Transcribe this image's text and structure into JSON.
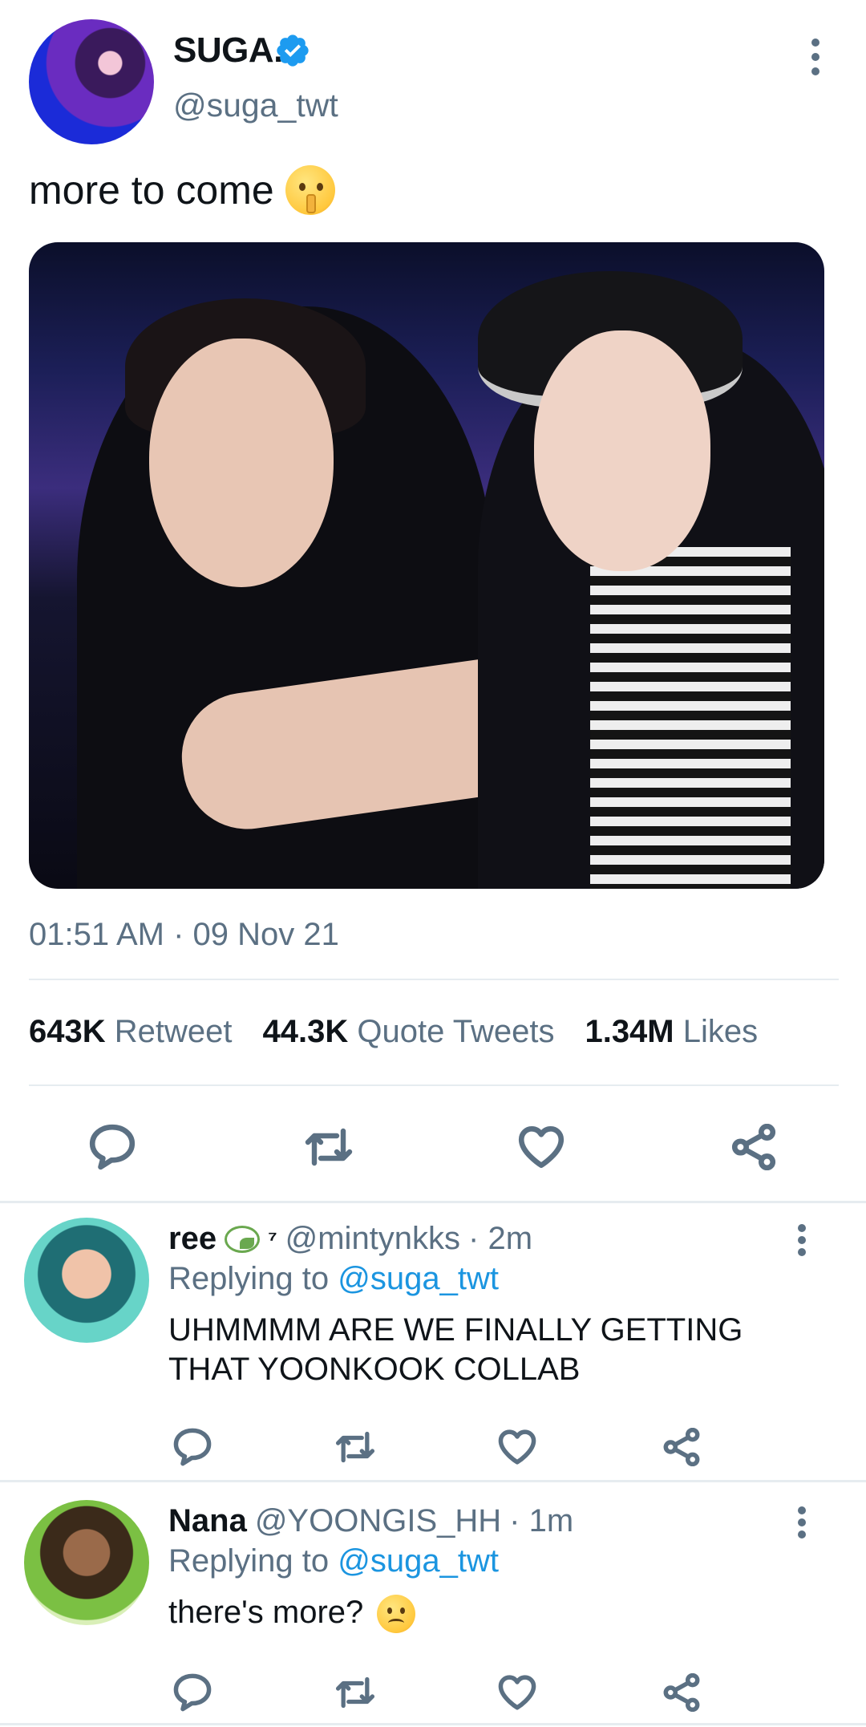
{
  "tweet": {
    "display_name": "SUGA.",
    "verified_icon": "verified-badge-icon",
    "handle": "@suga_twt",
    "text": "more to come",
    "text_emoji": "shushing-face",
    "media_description_icon": "photo",
    "timestamp": "01:51 AM · 09 Nov 21",
    "stats": {
      "retweets_count": "643K",
      "retweets_label": "Retweet",
      "quotes_count": "44.3K",
      "quotes_label": "Quote Tweets",
      "likes_count": "1.34M",
      "likes_label": "Likes"
    },
    "accent_color": "#1b95e0"
  },
  "replies": [
    {
      "name": "ree",
      "badge_icon": "leaf-icon",
      "badge_text": "⁷",
      "handle": "@mintynkks",
      "time": "· 2m",
      "replying_prefix": "Replying to",
      "replying_to": "@suga_twt",
      "text": "UHMMMM ARE WE FINALLY GETTING THAT YOONKOOK COLLAB"
    },
    {
      "name": "Nana",
      "handle": "@YOONGIS_HH",
      "time": "· 1m",
      "replying_prefix": "Replying to",
      "replying_to": "@suga_twt",
      "text": "there's more?",
      "text_emoji": "slightly-frowning-face"
    }
  ]
}
